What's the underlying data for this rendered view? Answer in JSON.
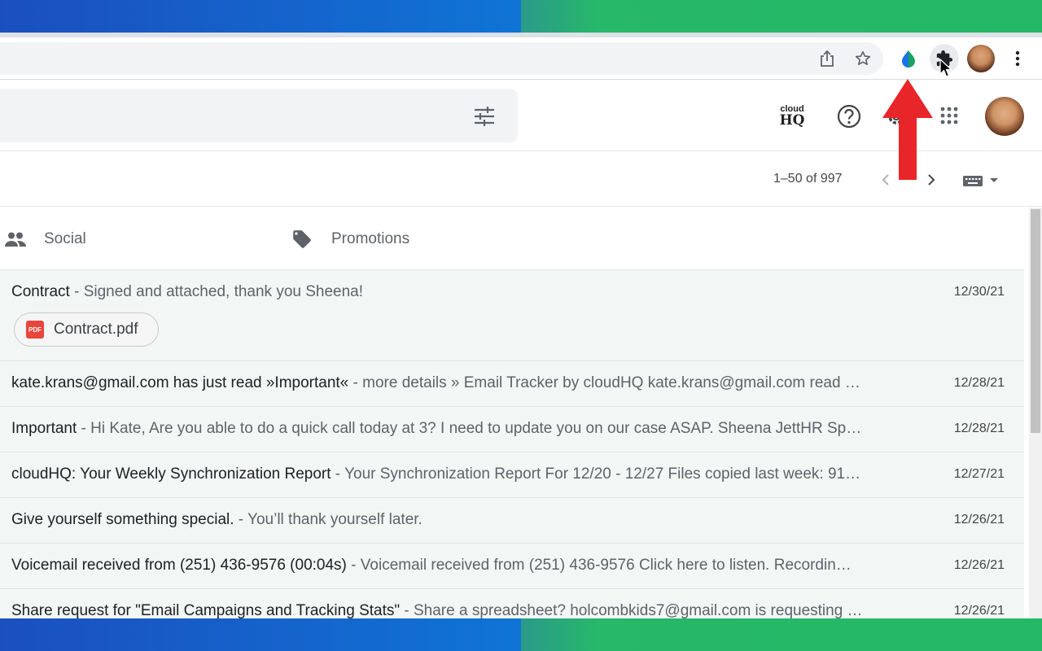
{
  "colors": {
    "band_blue": "#1565c0",
    "band_green": "#22b865",
    "arrow_red": "#e8262a",
    "pdf_red": "#e8453c"
  },
  "browser": {
    "icons": [
      "share-icon",
      "bookmark-star-icon",
      "extension-drop-icon",
      "puzzle-extensions-icon",
      "profile-avatar",
      "more-vert-icon"
    ]
  },
  "header": {
    "cloudhq_top": "cloud",
    "cloudhq_bottom": "HQ",
    "icons": [
      "search-options-icon",
      "cloudhq-logo",
      "help-icon",
      "settings-icon",
      "apps-grid-icon",
      "account-avatar"
    ]
  },
  "toolbar": {
    "pager": "1–50 of 997"
  },
  "tabs": [
    {
      "label": "Social",
      "icon": "people-icon"
    },
    {
      "label": "Promotions",
      "icon": "tag-icon"
    }
  ],
  "emails": [
    {
      "subject": "Contract",
      "snippet": " - Signed and attached, thank you Sheena!",
      "date": "12/30/21",
      "attachment": "Contract.pdf",
      "attachment_type": "PDF"
    },
    {
      "subject": "kate.krans@gmail.com has just read »Important«",
      "snippet": " - more details » Email Tracker by cloudHQ kate.krans@gmail.com read …",
      "date": "12/28/21"
    },
    {
      "subject": "Important",
      "snippet": " - Hi Kate, Are you able to do a quick call today at 3? I need to update you on our case ASAP. Sheena JettHR Sp…",
      "date": "12/28/21"
    },
    {
      "subject": "cloudHQ: Your Weekly Synchronization Report",
      "snippet": " - Your Synchronization Report For 12/20 - 12/27 Files copied last week: 91…",
      "date": "12/27/21"
    },
    {
      "subject": "Give yourself something special.",
      "snippet": " - You’ll thank yourself later.",
      "date": "12/26/21"
    },
    {
      "subject": "Voicemail received from (251) 436-9576 (00:04s)",
      "snippet": " - Voicemail received from (251) 436-9576 Click here to listen. Recordin…",
      "date": "12/26/21"
    },
    {
      "subject": "Share request for \"Email Campaigns and Tracking Stats\"",
      "snippet": " - Share a spreadsheet? holcombkids7@gmail.com is requesting …",
      "date": "12/26/21"
    }
  ]
}
